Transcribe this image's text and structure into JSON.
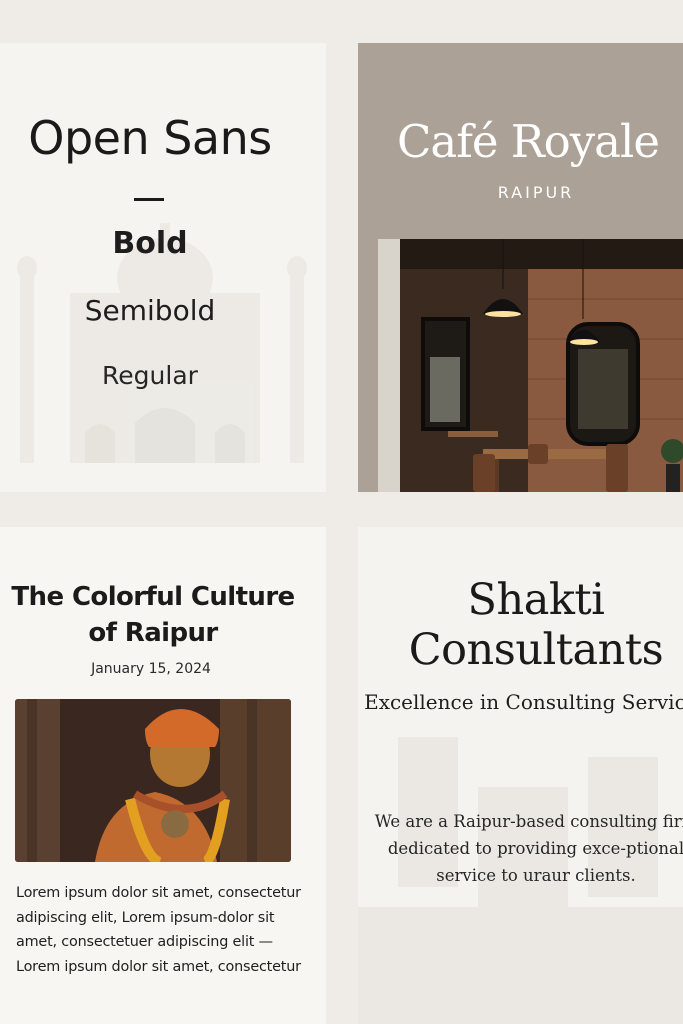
{
  "font_card": {
    "font_name": "Open Sans",
    "weights": [
      "Bold",
      "Semibold",
      "Regular"
    ]
  },
  "cafe_card": {
    "name": "Café Royale",
    "city": "RAIPUR"
  },
  "blog_card": {
    "title": "The Colorful Culture of Raipur",
    "date": "January 15, 2024",
    "body": "Lorem ipsum dolor sit amet, consectetur adipiscing elit, Lorem  ipsum-dolor sit amet, consectetuer adipiscing elit — Lorem ipsum dolor sit amet, consectetur"
  },
  "consult_card": {
    "name": "Shakti Consultants",
    "tagline": "Excellence in Consulting Services",
    "description": "We are a Raipur-based consulting firm dedicated to providing exce-ptional service to uraur clients."
  },
  "colors": {
    "page_bg": "#efece7",
    "card_bg": "#f6f4f0",
    "cafe_bg": "#aca196",
    "text_dark": "#1a1a1a"
  }
}
